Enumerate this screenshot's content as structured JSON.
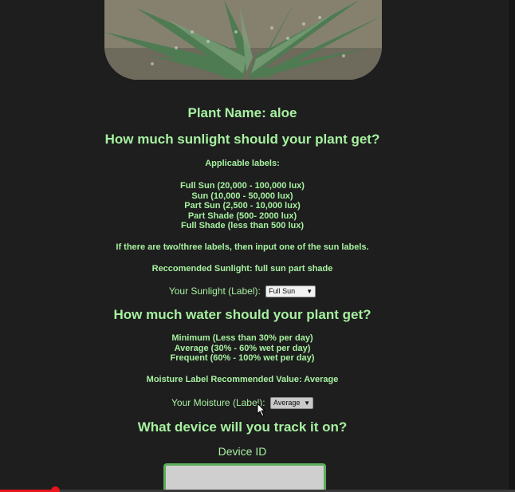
{
  "plant": {
    "name_heading": "Plant Name: aloe"
  },
  "sunlight": {
    "heading": "How much sunlight should your plant get?",
    "applicable_title": "Applicable labels:",
    "labels": [
      "Full Sun (20,000 - 100,000 lux)",
      "Sun (10,000 - 50,000 lux)",
      "Part Sun (2,500 - 10,000 lux)",
      "Part Shade (500- 2000 lux)",
      "Full Shade (less than 500 lux)"
    ],
    "note": "If there are two/three labels, then input one of the sun labels.",
    "recommended": "Reccomended Sunlight: full sun part shade",
    "input_label": "Your Sunlight (Label):",
    "selected": "Full Sun"
  },
  "water": {
    "heading": "How much water should your plant get?",
    "levels": [
      "Minimum (Less than 30% per day)",
      "Average (30% - 60% wet per day)",
      "Frequent (60% - 100% wet per day)"
    ],
    "recommended": "Moisture Label Recommended Value: Average",
    "input_label": "Your Moisture (Label):",
    "selected": "Average"
  },
  "device": {
    "heading": "What device will you track it on?",
    "id_label": "Device ID",
    "id_value": ""
  },
  "video": {
    "progress_fraction": 0.107
  },
  "colors": {
    "background": "#1e1e1e",
    "text_green": "#a6f0a0",
    "input_border_green": "#5cae5a",
    "progress_red": "#e6161b"
  },
  "icons": {
    "cursor": "mouse-pointer-icon",
    "dropdown": "chevron-down-icon"
  }
}
